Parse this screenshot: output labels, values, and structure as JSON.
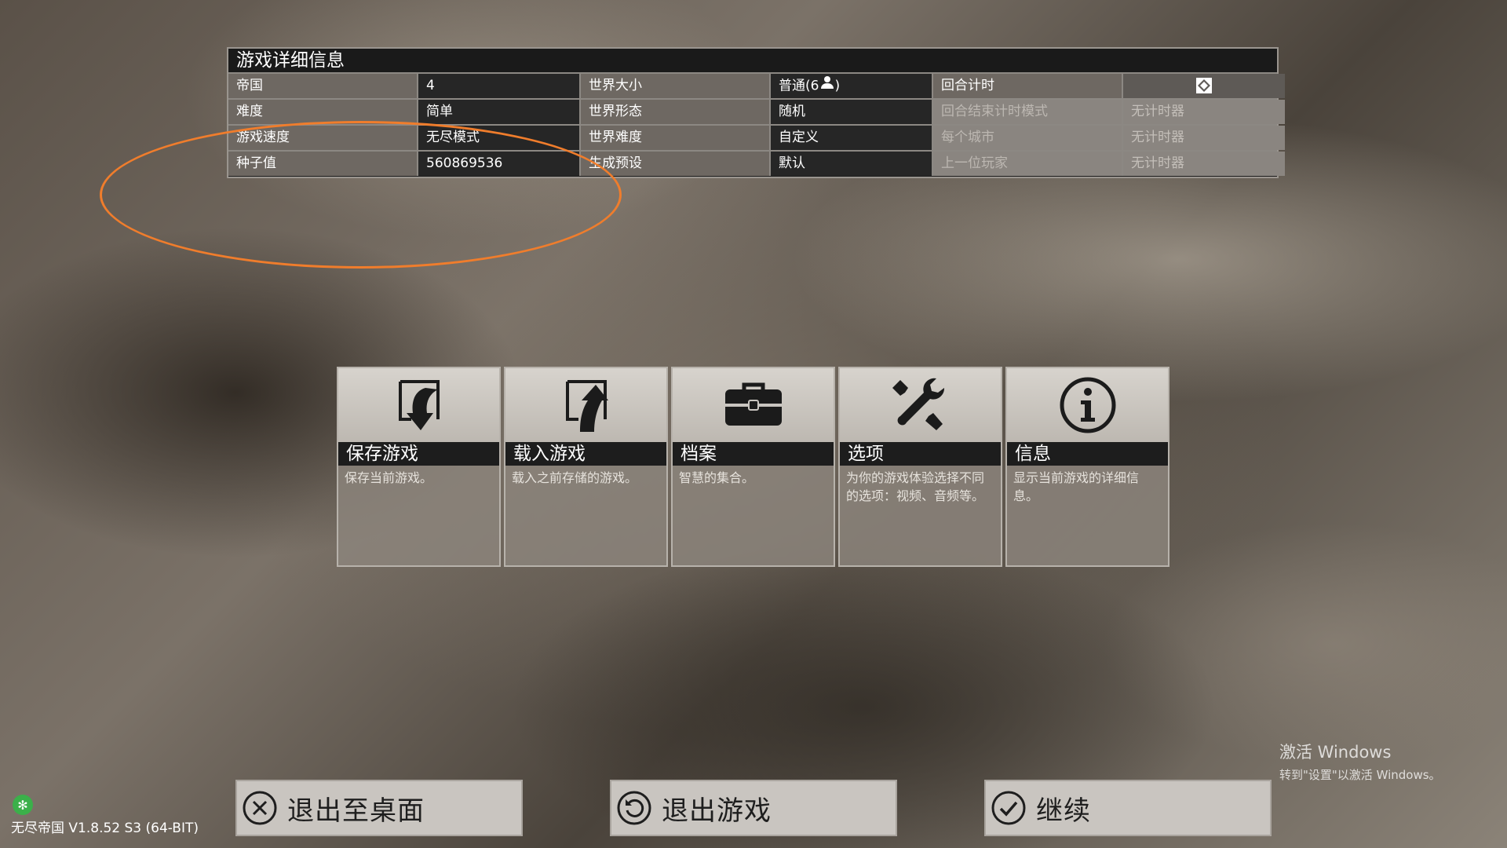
{
  "details": {
    "title": "游戏详细信息",
    "rows": [
      {
        "l1": "帝国",
        "v1": "4",
        "l2": "世界大小",
        "v2": "普通(6",
        "l3": "回合计时"
      },
      {
        "l1": "难度",
        "v1": "简单",
        "l2": "世界形态",
        "v2": "随机",
        "l3": "回合结束计时模式",
        "v3": "无计时器"
      },
      {
        "l1": "游戏速度",
        "v1": "无尽模式",
        "l2": "世界难度",
        "v2": "自定义",
        "l3": "每个城市",
        "v3": "无计时器"
      },
      {
        "l1": "种子值",
        "v1": "560869536",
        "l2": "生成预设",
        "v2": "默认",
        "l3": "上一位玩家",
        "v3": "无计时器"
      }
    ]
  },
  "menu": [
    {
      "title": "保存游戏",
      "desc": "保存当前游戏。",
      "icon": "save-icon"
    },
    {
      "title": "载入游戏",
      "desc": "载入之前存储的游戏。",
      "icon": "load-icon"
    },
    {
      "title": "档案",
      "desc": "智慧的集合。",
      "icon": "briefcase-icon"
    },
    {
      "title": "选项",
      "desc": "为你的游戏体验选择不同的选项：视频、音频等。",
      "icon": "tools-icon"
    },
    {
      "title": "信息",
      "desc": "显示当前游戏的详细信息。",
      "icon": "info-icon"
    }
  ],
  "buttons": {
    "exit_desktop": "退出至桌面",
    "exit_game": "退出游戏",
    "continue": "继续"
  },
  "version": "无尽帝国 V1.8.52 S3 (64-BIT)",
  "activate": {
    "line1": "激活 Windows",
    "line2": "转到\"设置\"以激活 Windows。"
  },
  "colors": {
    "highlight": "#f07d2c",
    "status_dot": "#3bb04a"
  }
}
